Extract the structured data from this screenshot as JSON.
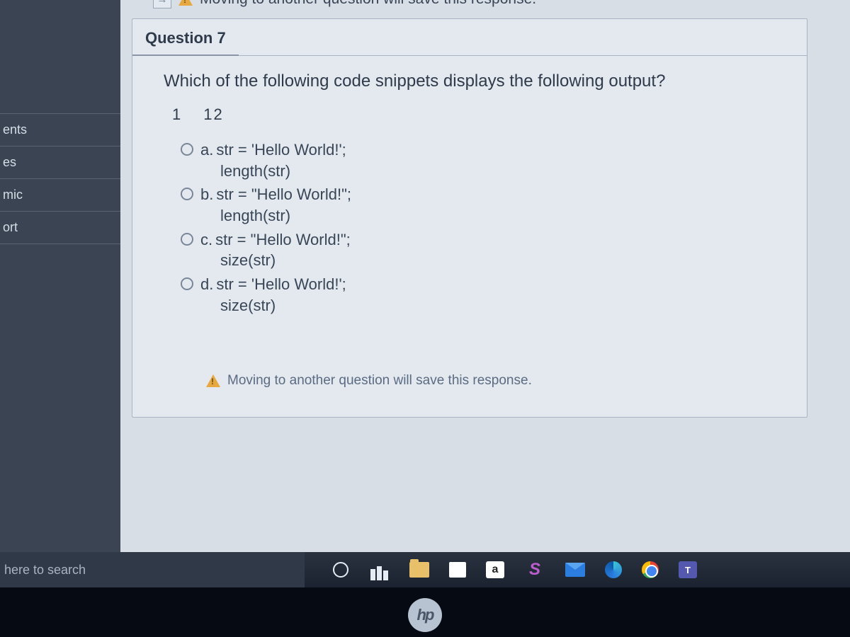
{
  "warning_text": "Moving to another question will save this response.",
  "question": {
    "header": "Question 7",
    "prompt": "Which of the following code snippets displays the following output?",
    "output_tokens": [
      "1",
      "12"
    ],
    "options": [
      {
        "letter": "a.",
        "line1": "str = 'Hello World!';",
        "line2": "length(str)"
      },
      {
        "letter": "b.",
        "line1": "str = \"Hello World!\";",
        "line2": "length(str)"
      },
      {
        "letter": "c.",
        "line1": "str = \"Hello World!\";",
        "line2": "size(str)"
      },
      {
        "letter": "d.",
        "line1": "str = 'Hello World!';",
        "line2": "size(str)"
      }
    ]
  },
  "sidebar": {
    "items": [
      "ents",
      "es",
      "mic",
      "ort"
    ]
  },
  "taskbar": {
    "search_placeholder": "here to search",
    "amz_label": "a",
    "teams_label": "T",
    "hp_label": "hp"
  }
}
